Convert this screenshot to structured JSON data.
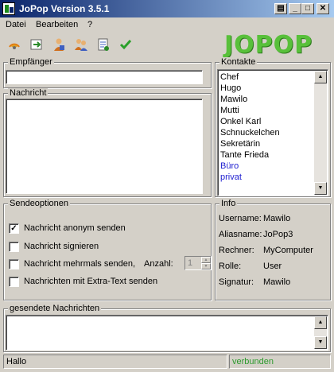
{
  "window": {
    "title": "JoPop Version 3.5.1",
    "controls": {
      "print": "▤",
      "minimize": "_",
      "maximize": "□",
      "close": "✕"
    }
  },
  "menu": {
    "items": [
      "Datei",
      "Bearbeiten",
      "?"
    ]
  },
  "toolbar": {
    "icons": [
      "broadcast-icon",
      "refresh-icon",
      "user-icon",
      "users-icon",
      "document-icon",
      "checkmark-icon"
    ]
  },
  "logo": {
    "text": "JOPOP",
    "color": "#58c03a"
  },
  "empfaenger": {
    "label": "Empfänger",
    "value": ""
  },
  "nachricht": {
    "label": "Nachricht",
    "value": ""
  },
  "kontakte": {
    "label": "Kontakte",
    "items": [
      {
        "name": "Chef",
        "is_group": false
      },
      {
        "name": "Hugo",
        "is_group": false
      },
      {
        "name": "Mawilo",
        "is_group": false
      },
      {
        "name": "Mutti",
        "is_group": false
      },
      {
        "name": "Onkel Karl",
        "is_group": false
      },
      {
        "name": "Schnuckelchen",
        "is_group": false
      },
      {
        "name": "Sekretärin",
        "is_group": false
      },
      {
        "name": "Tante Frieda",
        "is_group": false
      },
      {
        "name": "Büro",
        "is_group": true
      },
      {
        "name": "privat",
        "is_group": true
      }
    ]
  },
  "sendeoptionen": {
    "label": "Sendeoptionen",
    "options": [
      {
        "label": "Nachricht anonym senden",
        "checked": true
      },
      {
        "label": "Nachricht signieren",
        "checked": false
      },
      {
        "label": "Nachricht mehrmals senden,",
        "checked": false
      },
      {
        "label": "Nachrichten mit Extra-Text senden",
        "checked": false
      }
    ],
    "anzahl_label": "Anzahl:",
    "anzahl_value": "1"
  },
  "info": {
    "label": "Info",
    "rows": [
      {
        "key": "Username:",
        "value": "Mawilo"
      },
      {
        "key": "Aliasname:",
        "value": "JoPop3"
      },
      {
        "key": "Rechner:",
        "value": "MyComputer"
      },
      {
        "key": "Rolle:",
        "value": "User"
      },
      {
        "key": "Signatur:",
        "value": "Mawilo"
      }
    ]
  },
  "gesendete": {
    "label": "gesendete Nachrichten",
    "value": ""
  },
  "status": {
    "message": "Hallo",
    "connection": "verbunden",
    "connection_color": "#2e9a2e"
  }
}
